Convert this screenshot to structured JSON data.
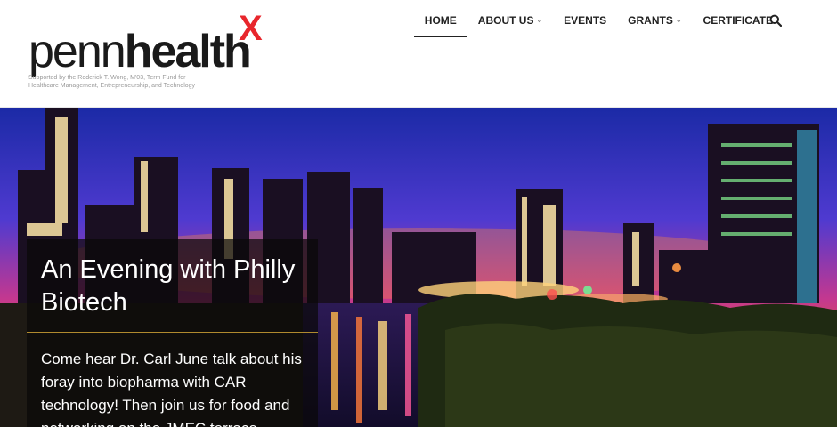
{
  "logo": {
    "word_light": "penn",
    "word_bold": "health",
    "mark": "X",
    "tagline": "Supported by the Roderick T. Wong, M'03, Term Fund for Healthcare Management, Entrepreneurship, and Technology"
  },
  "nav": {
    "items": [
      {
        "label": "HOME",
        "active": true,
        "dropdown": false
      },
      {
        "label": "ABOUT US",
        "active": false,
        "dropdown": true
      },
      {
        "label": "EVENTS",
        "active": false,
        "dropdown": false
      },
      {
        "label": "GRANTS",
        "active": false,
        "dropdown": true
      },
      {
        "label": "CERTIFICATE",
        "active": false,
        "dropdown": false
      }
    ],
    "search_icon": "search-icon"
  },
  "hero": {
    "caption_title": "An Evening with Philly Biotech",
    "caption_body": "Come hear Dr. Carl June talk about his foray into biopharma with CAR technology! Then join us for food and networking on the JMEC terrace."
  },
  "colors": {
    "accent_x": "#e8262c",
    "text_dark": "#222222",
    "caption_rule": "#b08a2e"
  }
}
